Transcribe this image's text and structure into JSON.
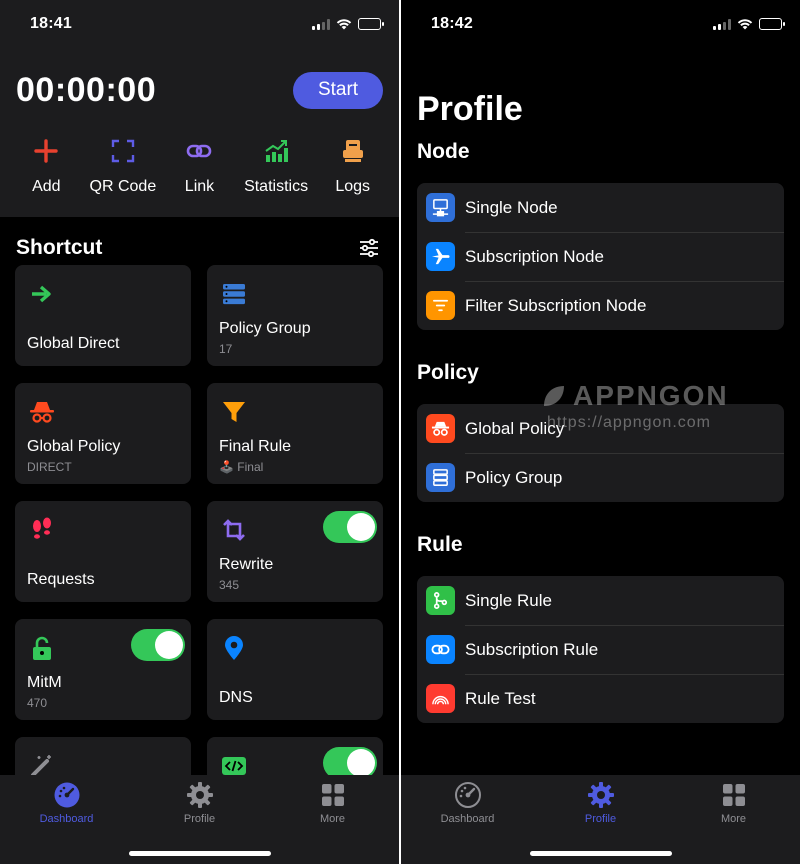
{
  "left": {
    "status": {
      "time": "18:41"
    },
    "timer": "00:00:00",
    "start_label": "Start",
    "actions": [
      {
        "label": "Add",
        "icon": "plus-icon",
        "color": "#e8412f"
      },
      {
        "label": "QR Code",
        "icon": "qr-scan-icon",
        "color": "#5e5ce6"
      },
      {
        "label": "Link",
        "icon": "link-icon",
        "color": "#8e6cf0"
      },
      {
        "label": "Statistics",
        "icon": "chart-icon",
        "color": "#34c759"
      },
      {
        "label": "Logs",
        "icon": "logs-icon",
        "color": "#f0a04b"
      }
    ],
    "shortcut_title": "Shortcut",
    "tiles": [
      {
        "label": "Global Direct",
        "sub": "",
        "icon": "arrow-right-icon",
        "color": "#34c759"
      },
      {
        "label": "Policy Group",
        "sub": "17",
        "icon": "server-stack-icon",
        "color": "#3a7bd5"
      },
      {
        "label": "Global Policy",
        "sub": "DIRECT",
        "icon": "incognito-icon",
        "color": "#ff4a1f"
      },
      {
        "label": "Final Rule",
        "sub": "🕹️ Final",
        "icon": "filter-icon",
        "color": "#ff9f0a"
      },
      {
        "label": "Requests",
        "sub": "",
        "icon": "footprints-icon",
        "color": "#ff2d55"
      },
      {
        "label": "Rewrite",
        "sub": "345",
        "icon": "repeat-icon",
        "color": "#8e6cf0",
        "toggle": true
      },
      {
        "label": "MitM",
        "sub": "470",
        "icon": "lock-icon",
        "color": "#34c759",
        "toggle": true
      },
      {
        "label": "DNS",
        "sub": "",
        "icon": "map-pin-icon",
        "color": "#0a84ff"
      },
      {
        "label": "",
        "sub": "",
        "icon": "magic-wand-icon",
        "color": "#8e8e93"
      },
      {
        "label": "",
        "sub": "",
        "icon": "code-icon",
        "color": "#34c759",
        "toggle": true
      }
    ],
    "tabs": [
      {
        "label": "Dashboard",
        "icon": "dashboard-icon",
        "active": true
      },
      {
        "label": "Profile",
        "icon": "gear-icon",
        "active": false
      },
      {
        "label": "More",
        "icon": "grid-icon",
        "active": false
      }
    ]
  },
  "right": {
    "status": {
      "time": "18:42"
    },
    "title": "Profile",
    "sections": [
      {
        "title": "Node",
        "rows": [
          {
            "label": "Single Node",
            "icon": "server-icon",
            "color": "#2f6fd8"
          },
          {
            "label": "Subscription Node",
            "icon": "airplane-icon",
            "color": "#0a84ff"
          },
          {
            "label": "Filter Subscription Node",
            "icon": "filter-lines-icon",
            "color": "#ff9500"
          }
        ]
      },
      {
        "title": "Policy",
        "rows": [
          {
            "label": "Global Policy",
            "icon": "incognito-icon",
            "color": "#ff4a1f"
          },
          {
            "label": "Policy Group",
            "icon": "server-stack-icon",
            "color": "#2f6fd8"
          }
        ]
      },
      {
        "title": "Rule",
        "rows": [
          {
            "label": "Single Rule",
            "icon": "branch-icon",
            "color": "#30c048"
          },
          {
            "label": "Subscription Rule",
            "icon": "link-icon",
            "color": "#0a84ff"
          },
          {
            "label": "Rule Test",
            "icon": "rainbow-icon",
            "color": "#ff3b30"
          }
        ]
      }
    ],
    "watermark": {
      "brand": "APPNGON",
      "url": "https://appngon.com"
    },
    "tabs": [
      {
        "label": "Dashboard",
        "icon": "dashboard-icon",
        "active": false
      },
      {
        "label": "Profile",
        "icon": "gear-icon",
        "active": true
      },
      {
        "label": "More",
        "icon": "grid-icon",
        "active": false
      }
    ]
  },
  "colors": {
    "accent": "#4f5be0",
    "toggle_on": "#34c759"
  }
}
